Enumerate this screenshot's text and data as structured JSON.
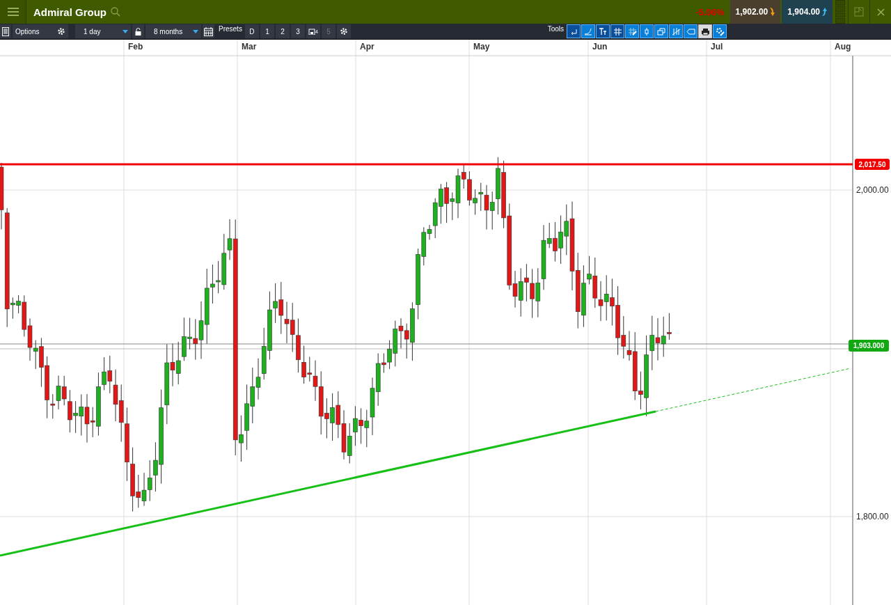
{
  "header": {
    "title": "Admiral Group",
    "change": "-5.06%",
    "sell": "1,902.00",
    "buy": "1,904.00"
  },
  "toolbar": {
    "options_label": "Options",
    "interval": "1 day",
    "range": "8 months",
    "presets_label": "Presets",
    "presets": [
      {
        "label": "D",
        "disabled": false
      },
      {
        "label": "1",
        "disabled": false
      },
      {
        "label": "2",
        "disabled": false
      },
      {
        "label": "3",
        "disabled": false
      },
      {
        "label": "4",
        "disabled": false,
        "kind": "saved"
      },
      {
        "label": "5",
        "disabled": true
      }
    ],
    "tools_label": "Tools"
  },
  "chart": {
    "months": [
      "Feb",
      "Mar",
      "Apr",
      "May",
      "Jun",
      "Jul",
      "Aug"
    ],
    "y_ticks": [
      "2,000.00",
      "1,800.00"
    ],
    "resistance_tag": "2,017.50",
    "current_tag": "1,903.000"
  }
}
